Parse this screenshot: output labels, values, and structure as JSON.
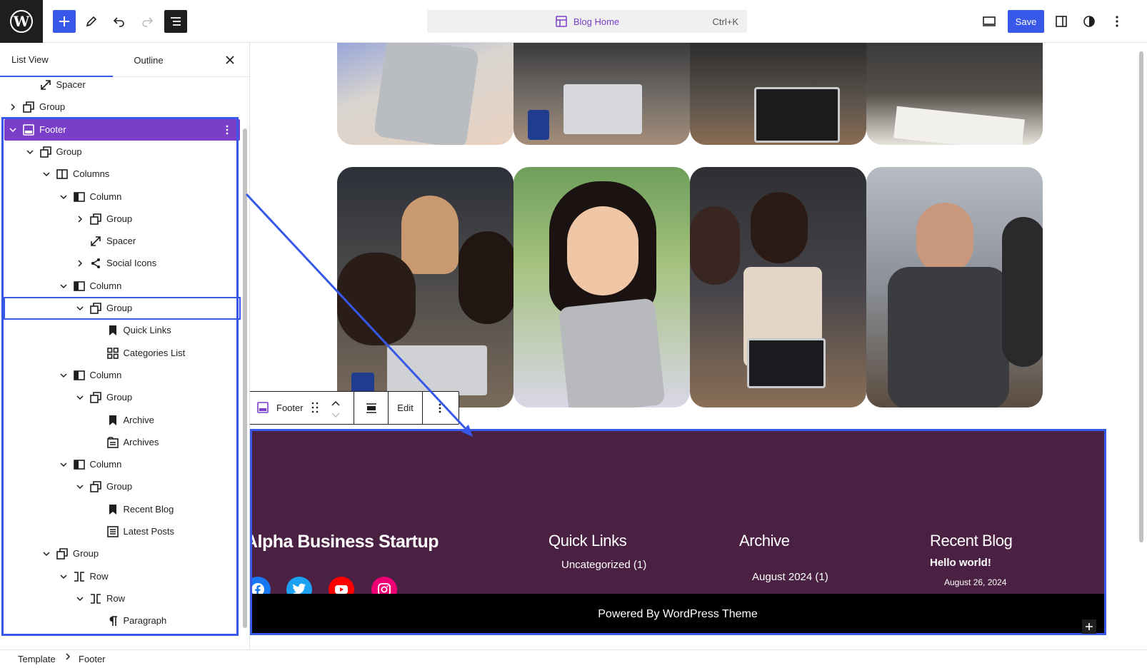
{
  "toolbar": {
    "command_title": "Blog Home",
    "command_shortcut": "Ctrl+K",
    "save_label": "Save"
  },
  "panel": {
    "tabs": [
      "List View",
      "Outline"
    ],
    "items": [
      {
        "label": "Spacer",
        "icon": "resize-icon"
      },
      {
        "label": "Group",
        "icon": "group-icon"
      },
      {
        "label": "Footer",
        "icon": "template-part-icon"
      },
      {
        "label": "Group",
        "icon": "group-icon"
      },
      {
        "label": "Columns",
        "icon": "columns-icon"
      },
      {
        "label": "Column",
        "icon": "column-icon"
      },
      {
        "label": "Group",
        "icon": "group-icon"
      },
      {
        "label": "Spacer",
        "icon": "resize-icon"
      },
      {
        "label": "Social Icons",
        "icon": "share-icon"
      },
      {
        "label": "Column",
        "icon": "column-icon"
      },
      {
        "label": "Group",
        "icon": "group-icon"
      },
      {
        "label": "Quick Links",
        "icon": "bookmark-icon"
      },
      {
        "label": "Categories List",
        "icon": "grid-icon"
      },
      {
        "label": "Column",
        "icon": "column-icon"
      },
      {
        "label": "Group",
        "icon": "group-icon"
      },
      {
        "label": "Archive",
        "icon": "bookmark-icon"
      },
      {
        "label": "Archives",
        "icon": "archive-icon"
      },
      {
        "label": "Column",
        "icon": "column-icon"
      },
      {
        "label": "Group",
        "icon": "group-icon"
      },
      {
        "label": "Recent Blog",
        "icon": "bookmark-icon"
      },
      {
        "label": "Latest Posts",
        "icon": "list-icon"
      },
      {
        "label": "Group",
        "icon": "group-icon"
      },
      {
        "label": "Row",
        "icon": "row-icon"
      },
      {
        "label": "Row",
        "icon": "row-icon"
      },
      {
        "label": "Paragraph",
        "icon": "paragraph-icon"
      }
    ]
  },
  "breadcrumb": [
    "Template",
    "Footer"
  ],
  "block_toolbar": {
    "name": "Footer",
    "edit_label": "Edit"
  },
  "footer": {
    "site_title": "Alpha Business Startup",
    "quick_links_heading": "Quick Links",
    "quick_links_item": "Uncategorized (1)",
    "archive_heading": "Archive",
    "archive_item": "August 2024 (1)",
    "recent_heading": "Recent Blog",
    "recent_post_title": "Hello world!",
    "recent_post_date": "August 26, 2024",
    "powered_by": "Powered By WordPress Theme"
  },
  "colors": {
    "accent": "#3858e9",
    "selection": "#7a3ec9",
    "footer_bg": "#4a2142",
    "footer_bottom_bg": "#000000",
    "facebook": "#1877f2",
    "twitter": "#1da1f2",
    "youtube": "#ff0000",
    "instagram": "#f00075"
  }
}
